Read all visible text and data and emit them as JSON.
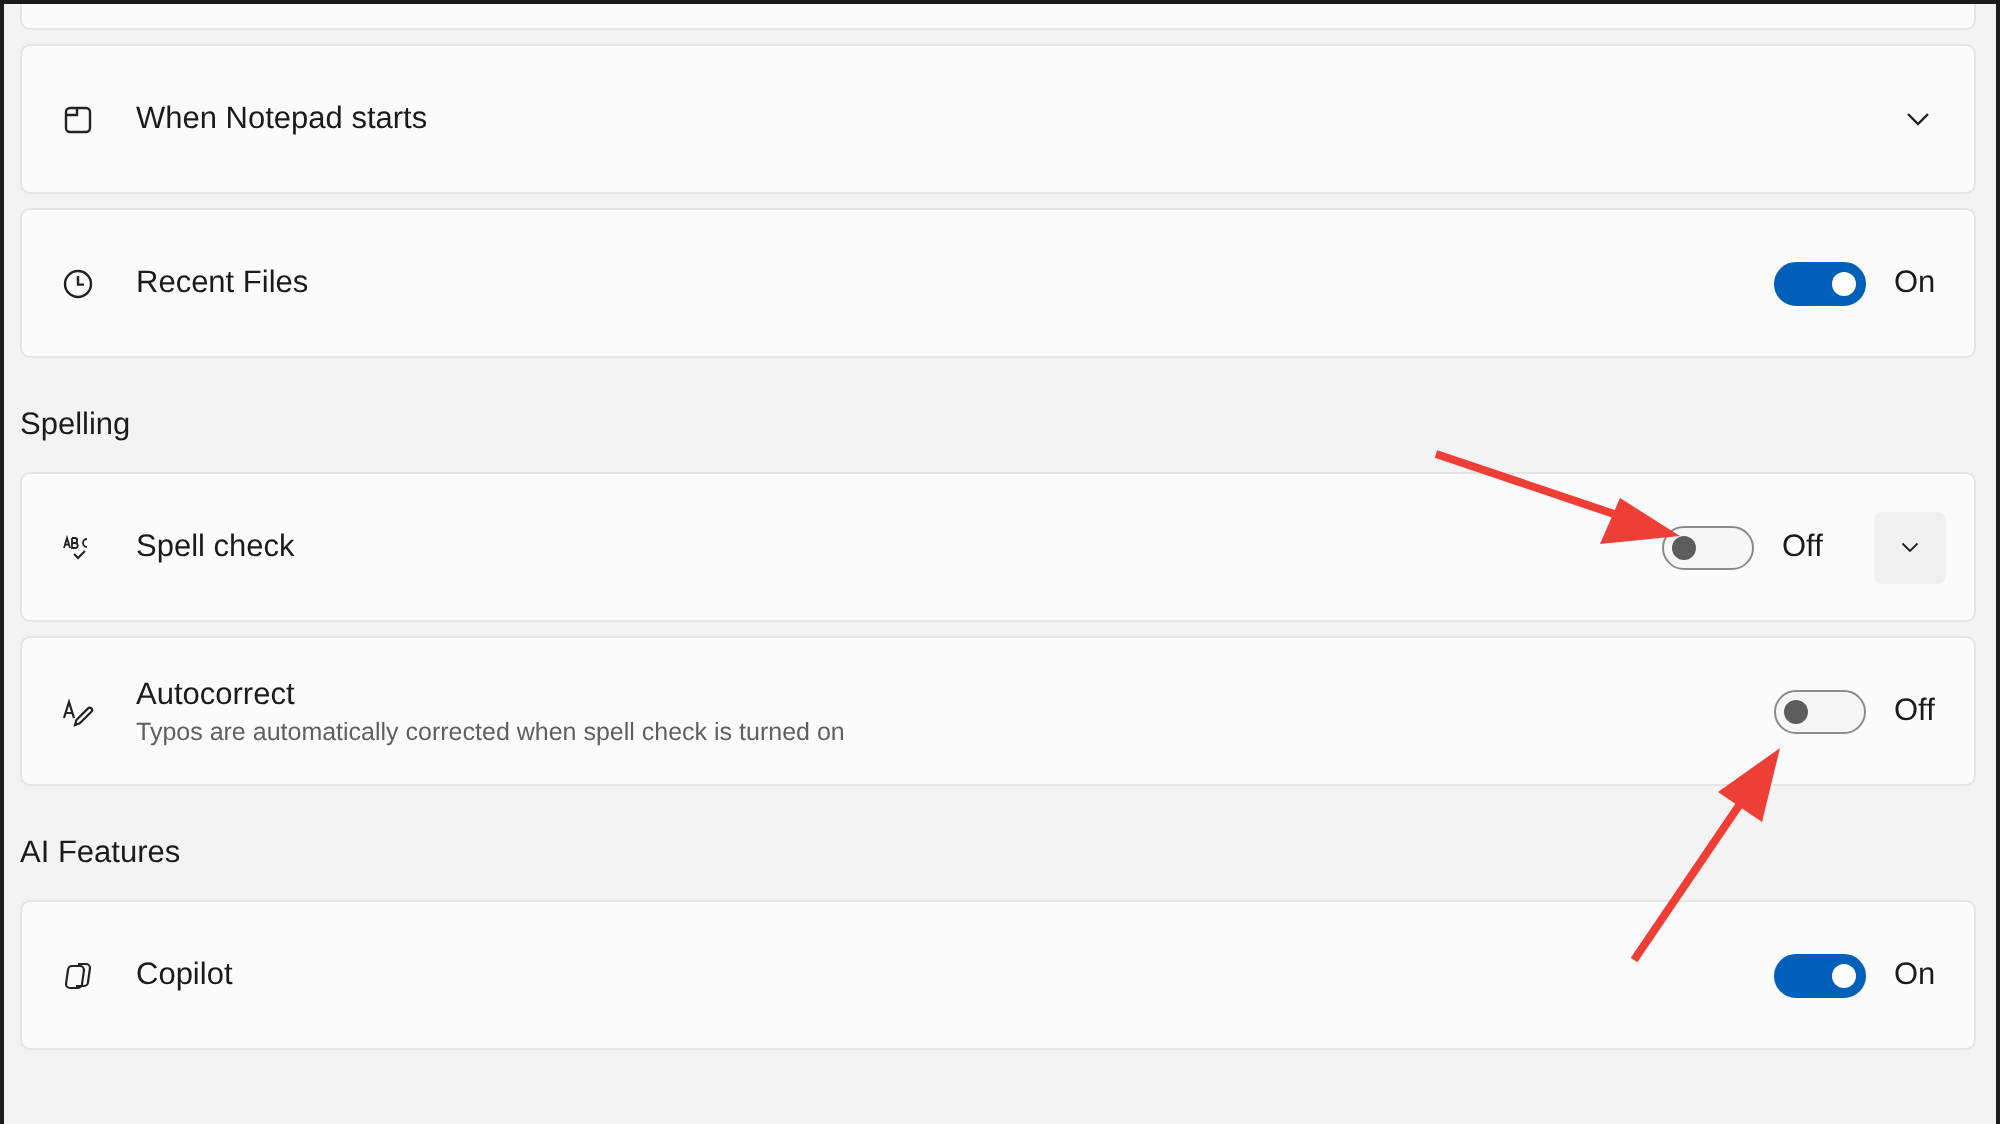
{
  "sections": [
    {
      "rows": [
        {
          "kind": "dropdown",
          "title": "When Notepad starts",
          "expanded": false
        },
        {
          "kind": "toggle",
          "title": "Recent Files",
          "on": true,
          "state_label": "On"
        }
      ]
    },
    {
      "header": "Spelling",
      "rows": [
        {
          "kind": "toggle-expand",
          "title": "Spell check",
          "on": false,
          "state_label": "Off"
        },
        {
          "kind": "toggle",
          "title": "Autocorrect",
          "subtitle": "Typos are automatically corrected when spell check is turned on",
          "on": false,
          "state_label": "Off"
        }
      ]
    },
    {
      "header": "AI Features",
      "rows": [
        {
          "kind": "toggle",
          "title": "Copilot",
          "on": true,
          "state_label": "On"
        }
      ]
    }
  ]
}
